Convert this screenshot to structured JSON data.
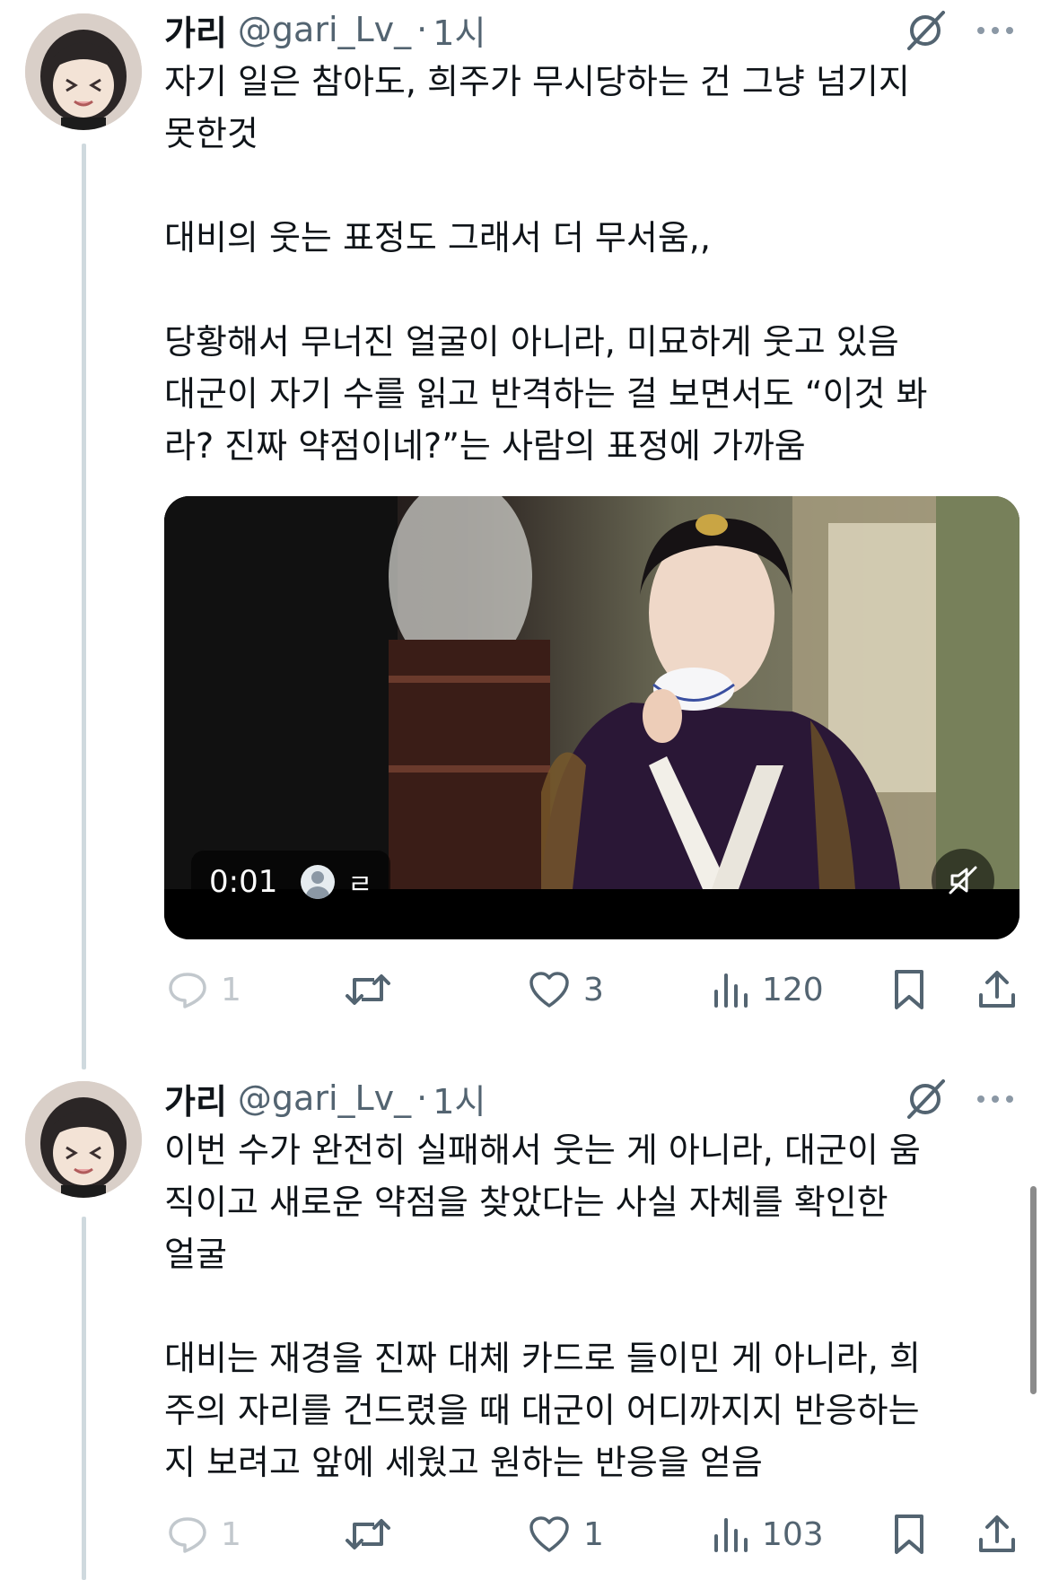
{
  "tweets": [
    {
      "author_name": "가리",
      "handle": "@gari_Lv_",
      "separator": "·",
      "time": "1시",
      "text": "자기 일은 참아도, 희주가 무시당하는 건 그냥 넘기지\n못한것\n\n대비의 웃는 표정도 그래서 더 무서움,,\n\n당황해서 무너진 얼굴이 아니라, 미묘하게 웃고 있음\n대군이 자기 수를 읽고 반격하는 걸 보면서도 “이것 봐\n라? 진짜 약점이네?”는 사람의 표정에 가까움",
      "media": {
        "video_time": "0:01",
        "video_user_label": "ㄹ"
      },
      "actions": {
        "replies": "1",
        "retweets": "",
        "likes": "3",
        "views": "120"
      }
    },
    {
      "author_name": "가리",
      "handle": "@gari_Lv_",
      "separator": "·",
      "time": "1시",
      "text": "이번 수가 완전히 실패해서 웃는 게 아니라, 대군이 움\n직이고 새로운 약점을 찾았다는 사실 자체를 확인한\n얼굴\n\n대비는 재경을 진짜 대체 카드로 들이민 게 아니라, 희\n주의 자리를 건드렸을 때 대군이 어디까지지 반응하는\n지 보려고 앞에 세웠고 원하는 반응을 얻음",
      "actions": {
        "replies": "1",
        "retweets": "",
        "likes": "1",
        "views": "103"
      }
    }
  ],
  "icons": {
    "grok": "grok-slash-icon",
    "more": "more-dots-icon",
    "reply": "reply-bubble-icon",
    "retweet": "retweet-icon",
    "like": "heart-icon",
    "views": "views-bar-icon",
    "bookmark": "bookmark-icon",
    "share": "share-upload-icon",
    "mute": "muted-speaker-icon"
  },
  "colors": {
    "text": "#0f1419",
    "secondary": "#536471",
    "thread_line": "#cfd9de",
    "background": "#ffffff"
  }
}
